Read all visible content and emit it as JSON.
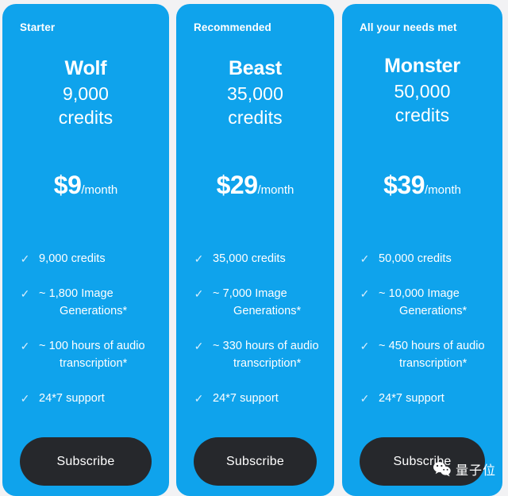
{
  "theme": {
    "card_background": "#0fa3ec",
    "page_background": "#f2f2f4",
    "button_background": "#26282c",
    "text_color": "#ffffff",
    "check_color": "#d6eefc"
  },
  "plans": [
    {
      "badge": "Starter",
      "name": "Wolf",
      "credits": "9,000",
      "credits_unit": "credits",
      "price_amount": "$9",
      "price_period": "/month",
      "features": [
        "9,000 credits",
        "~ 1,800 Image Generations*",
        "~ 100 hours of audio transcription*",
        "24*7 support"
      ],
      "cta_label": "Subscribe"
    },
    {
      "badge": "Recommended",
      "name": "Beast",
      "credits": "35,000",
      "credits_unit": "credits",
      "price_amount": "$29",
      "price_period": "/month",
      "features": [
        "35,000 credits",
        "~ 7,000 Image Generations*",
        "~ 330 hours of audio transcription*",
        "24*7 support"
      ],
      "cta_label": "Subscribe"
    },
    {
      "badge": "All your needs met",
      "name": "Monster",
      "credits": "50,000",
      "credits_unit": "credits",
      "price_amount": "$39",
      "price_period": "/month",
      "features": [
        "50,000 credits",
        "~ 10,000 Image Generations*",
        "~ 450 hours of audio transcription*",
        "24*7 support"
      ],
      "cta_label": "Subscribe"
    }
  ],
  "watermark": {
    "icon": "wechat-icon",
    "text": "量子位"
  },
  "icons": {
    "check": "✓"
  }
}
